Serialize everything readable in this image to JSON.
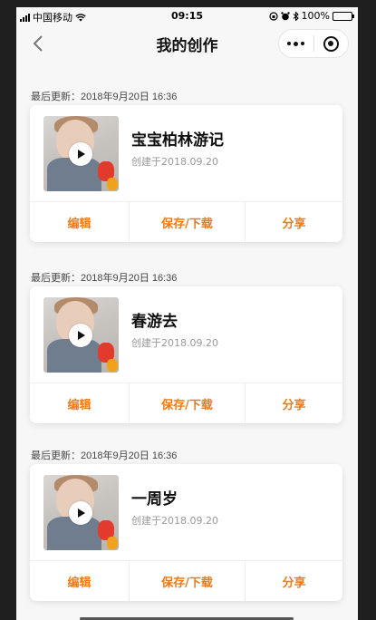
{
  "status_bar": {
    "carrier": "中国移动",
    "time": "09:15",
    "battery": "100%",
    "battery_level": 1.0
  },
  "nav": {
    "title": "我的创作",
    "back_icon": "chevron-left-icon",
    "more_icon": "more-dots-icon",
    "close_icon": "target-close-icon"
  },
  "works": [
    {
      "updated": "最后更新：2018年9月20日 16:36",
      "title": "宝宝柏林游记",
      "created": "创建于2018.09.20",
      "actions": {
        "edit": "编辑",
        "save": "保存/下载",
        "share": "分享"
      }
    },
    {
      "updated": "最后更新：2018年9月20日 16:36",
      "title": "春游去",
      "created": "创建于2018.09.20",
      "actions": {
        "edit": "编辑",
        "save": "保存/下载",
        "share": "分享"
      }
    },
    {
      "updated": "最后更新：2018年9月20日 16:36",
      "title": "一周岁",
      "created": "创建于2018.09.20",
      "actions": {
        "edit": "编辑",
        "save": "保存/下载",
        "share": "分享"
      }
    }
  ],
  "colors": {
    "accent": "#f07a16",
    "background": "#f7f7f7",
    "card": "#ffffff",
    "battery": "#35c759"
  }
}
